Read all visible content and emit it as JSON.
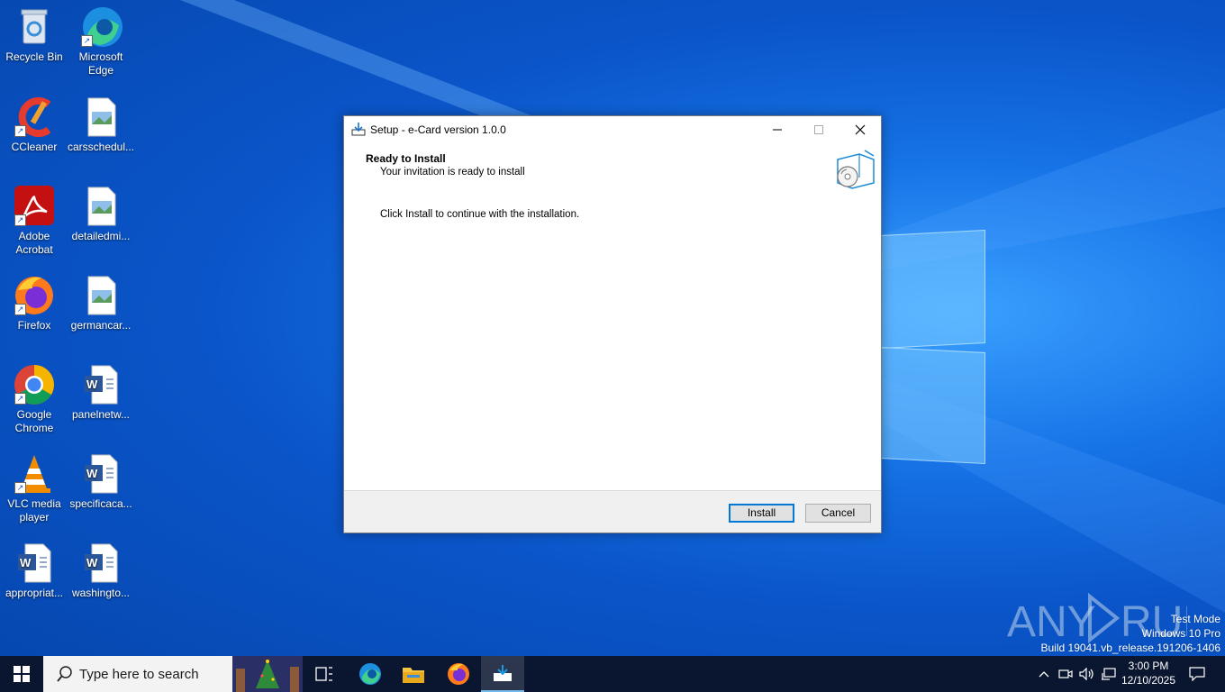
{
  "desktop": {
    "icons": [
      {
        "label": "Recycle Bin",
        "icon": "recycle-bin-icon"
      },
      {
        "label": "Microsoft Edge",
        "icon": "edge-icon"
      },
      {
        "label": "CCleaner",
        "icon": "ccleaner-icon"
      },
      {
        "label": "carsschedul...",
        "icon": "image-file-icon"
      },
      {
        "label": "Adobe Acrobat",
        "icon": "acrobat-icon"
      },
      {
        "label": "detailedmi...",
        "icon": "image-file-icon"
      },
      {
        "label": "Firefox",
        "icon": "firefox-icon"
      },
      {
        "label": "germancar...",
        "icon": "image-file-icon"
      },
      {
        "label": "Google Chrome",
        "icon": "chrome-icon"
      },
      {
        "label": "panelnetw...",
        "icon": "word-doc-icon"
      },
      {
        "label": "VLC media player",
        "icon": "vlc-icon"
      },
      {
        "label": "specificaca...",
        "icon": "word-doc-icon"
      },
      {
        "label": "appropriat...",
        "icon": "word-doc-icon"
      },
      {
        "label": "washingto...",
        "icon": "word-doc-icon"
      }
    ]
  },
  "dialog": {
    "title": "Setup - e-Card version 1.0.0",
    "heading": "Ready to Install",
    "subheading": "Your invitation is ready to install",
    "body": "Click Install to continue with the installation.",
    "install_label": "Install",
    "cancel_label": "Cancel"
  },
  "taskbar": {
    "search_placeholder": "Type here to search",
    "time": "3:00 PM",
    "date": "12/10/2025"
  },
  "watermark": {
    "line1": "Test Mode",
    "line2": "Windows 10 Pro",
    "line3": "Build 19041.vb_release.191206-1406",
    "brand": "ANY RUN"
  },
  "colors": {
    "desktop_blue": "#0a55c9",
    "accent": "#0078d7",
    "taskbar": "#0b1730"
  }
}
